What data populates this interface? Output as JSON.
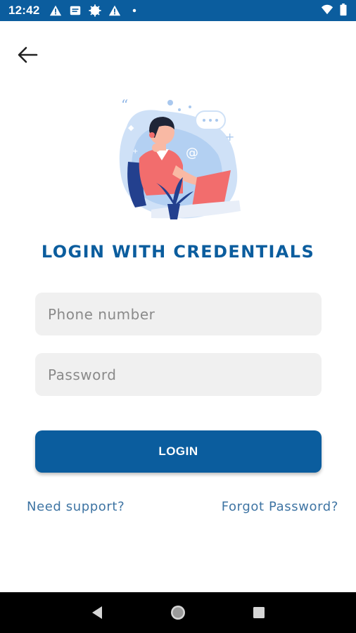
{
  "status_bar": {
    "time": "12:42",
    "left_icons": [
      "alert-triangle-icon",
      "message-icon",
      "gear-badge-icon",
      "alert-triangle-icon",
      "dot-icon"
    ],
    "right_icons": [
      "wifi-icon",
      "battery-icon"
    ]
  },
  "header": {
    "back_icon": "arrow-left-icon"
  },
  "login": {
    "title": "LOGIN WITH CREDENTIALS",
    "phone_placeholder": "Phone number",
    "phone_value": "",
    "password_placeholder": "Password",
    "password_value": "",
    "button_label": "LOGIN",
    "support_link": "Need support?",
    "forgot_link": "Forgot Password?"
  },
  "nav_bar": {
    "back": "triangle-back-icon",
    "home": "circle-home-icon",
    "recents": "square-recents-icon"
  },
  "colors": {
    "primary": "#0b5d9e",
    "link": "#3e74a3",
    "field_bg": "#f0f0f0"
  }
}
